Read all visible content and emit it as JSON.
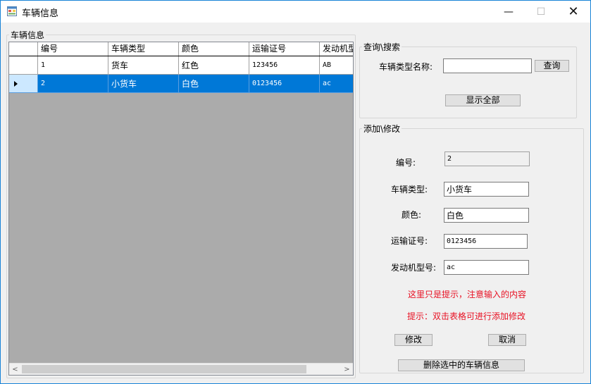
{
  "window": {
    "title": "车辆信息",
    "minimize_glyph": "—",
    "maximize_glyph": "☐",
    "close_glyph": "✕"
  },
  "grid_group": {
    "legend": "车辆信息",
    "columns": [
      "编号",
      "车辆类型",
      "颜色",
      "运输证号",
      "发动机型"
    ],
    "rows": [
      {
        "id": "1",
        "type": "货车",
        "color": "红色",
        "permit": "123456",
        "engine": "AB"
      },
      {
        "id": "2",
        "type": "小货车",
        "color": "白色",
        "permit": "0123456",
        "engine": "ac"
      }
    ],
    "selected_row_index": 1,
    "scroll_left": "<",
    "scroll_right": ">"
  },
  "search_group": {
    "legend": "查询\\搜索",
    "type_name_label": "车辆类型名称:",
    "type_name_value": "",
    "query_button": "查询",
    "show_all_button": "显示全部"
  },
  "edit_group": {
    "legend": "添加\\修改",
    "id_label": "编号:",
    "id_value": "2",
    "type_label": "车辆类型:",
    "type_value": "小货车",
    "color_label": "颜色:",
    "color_value": "白色",
    "permit_label": "运输证号:",
    "permit_value": "0123456",
    "engine_label": "发动机型号:",
    "engine_value": "ac",
    "hint1": "这里只是提示，注意输入的内容",
    "hint2": "提示：双击表格可进行添加修改",
    "modify_button": "修改",
    "cancel_button": "取消",
    "delete_button": "删除选中的车辆信息"
  },
  "colors": {
    "selection": "#0078d7",
    "hint_red": "#e81123",
    "window_border": "#1883d7"
  },
  "icons": [
    "form-app-icon",
    "minimize-icon",
    "maximize-icon",
    "close-icon",
    "row-pointer-icon",
    "scroll-left-icon",
    "scroll-right-icon"
  ]
}
